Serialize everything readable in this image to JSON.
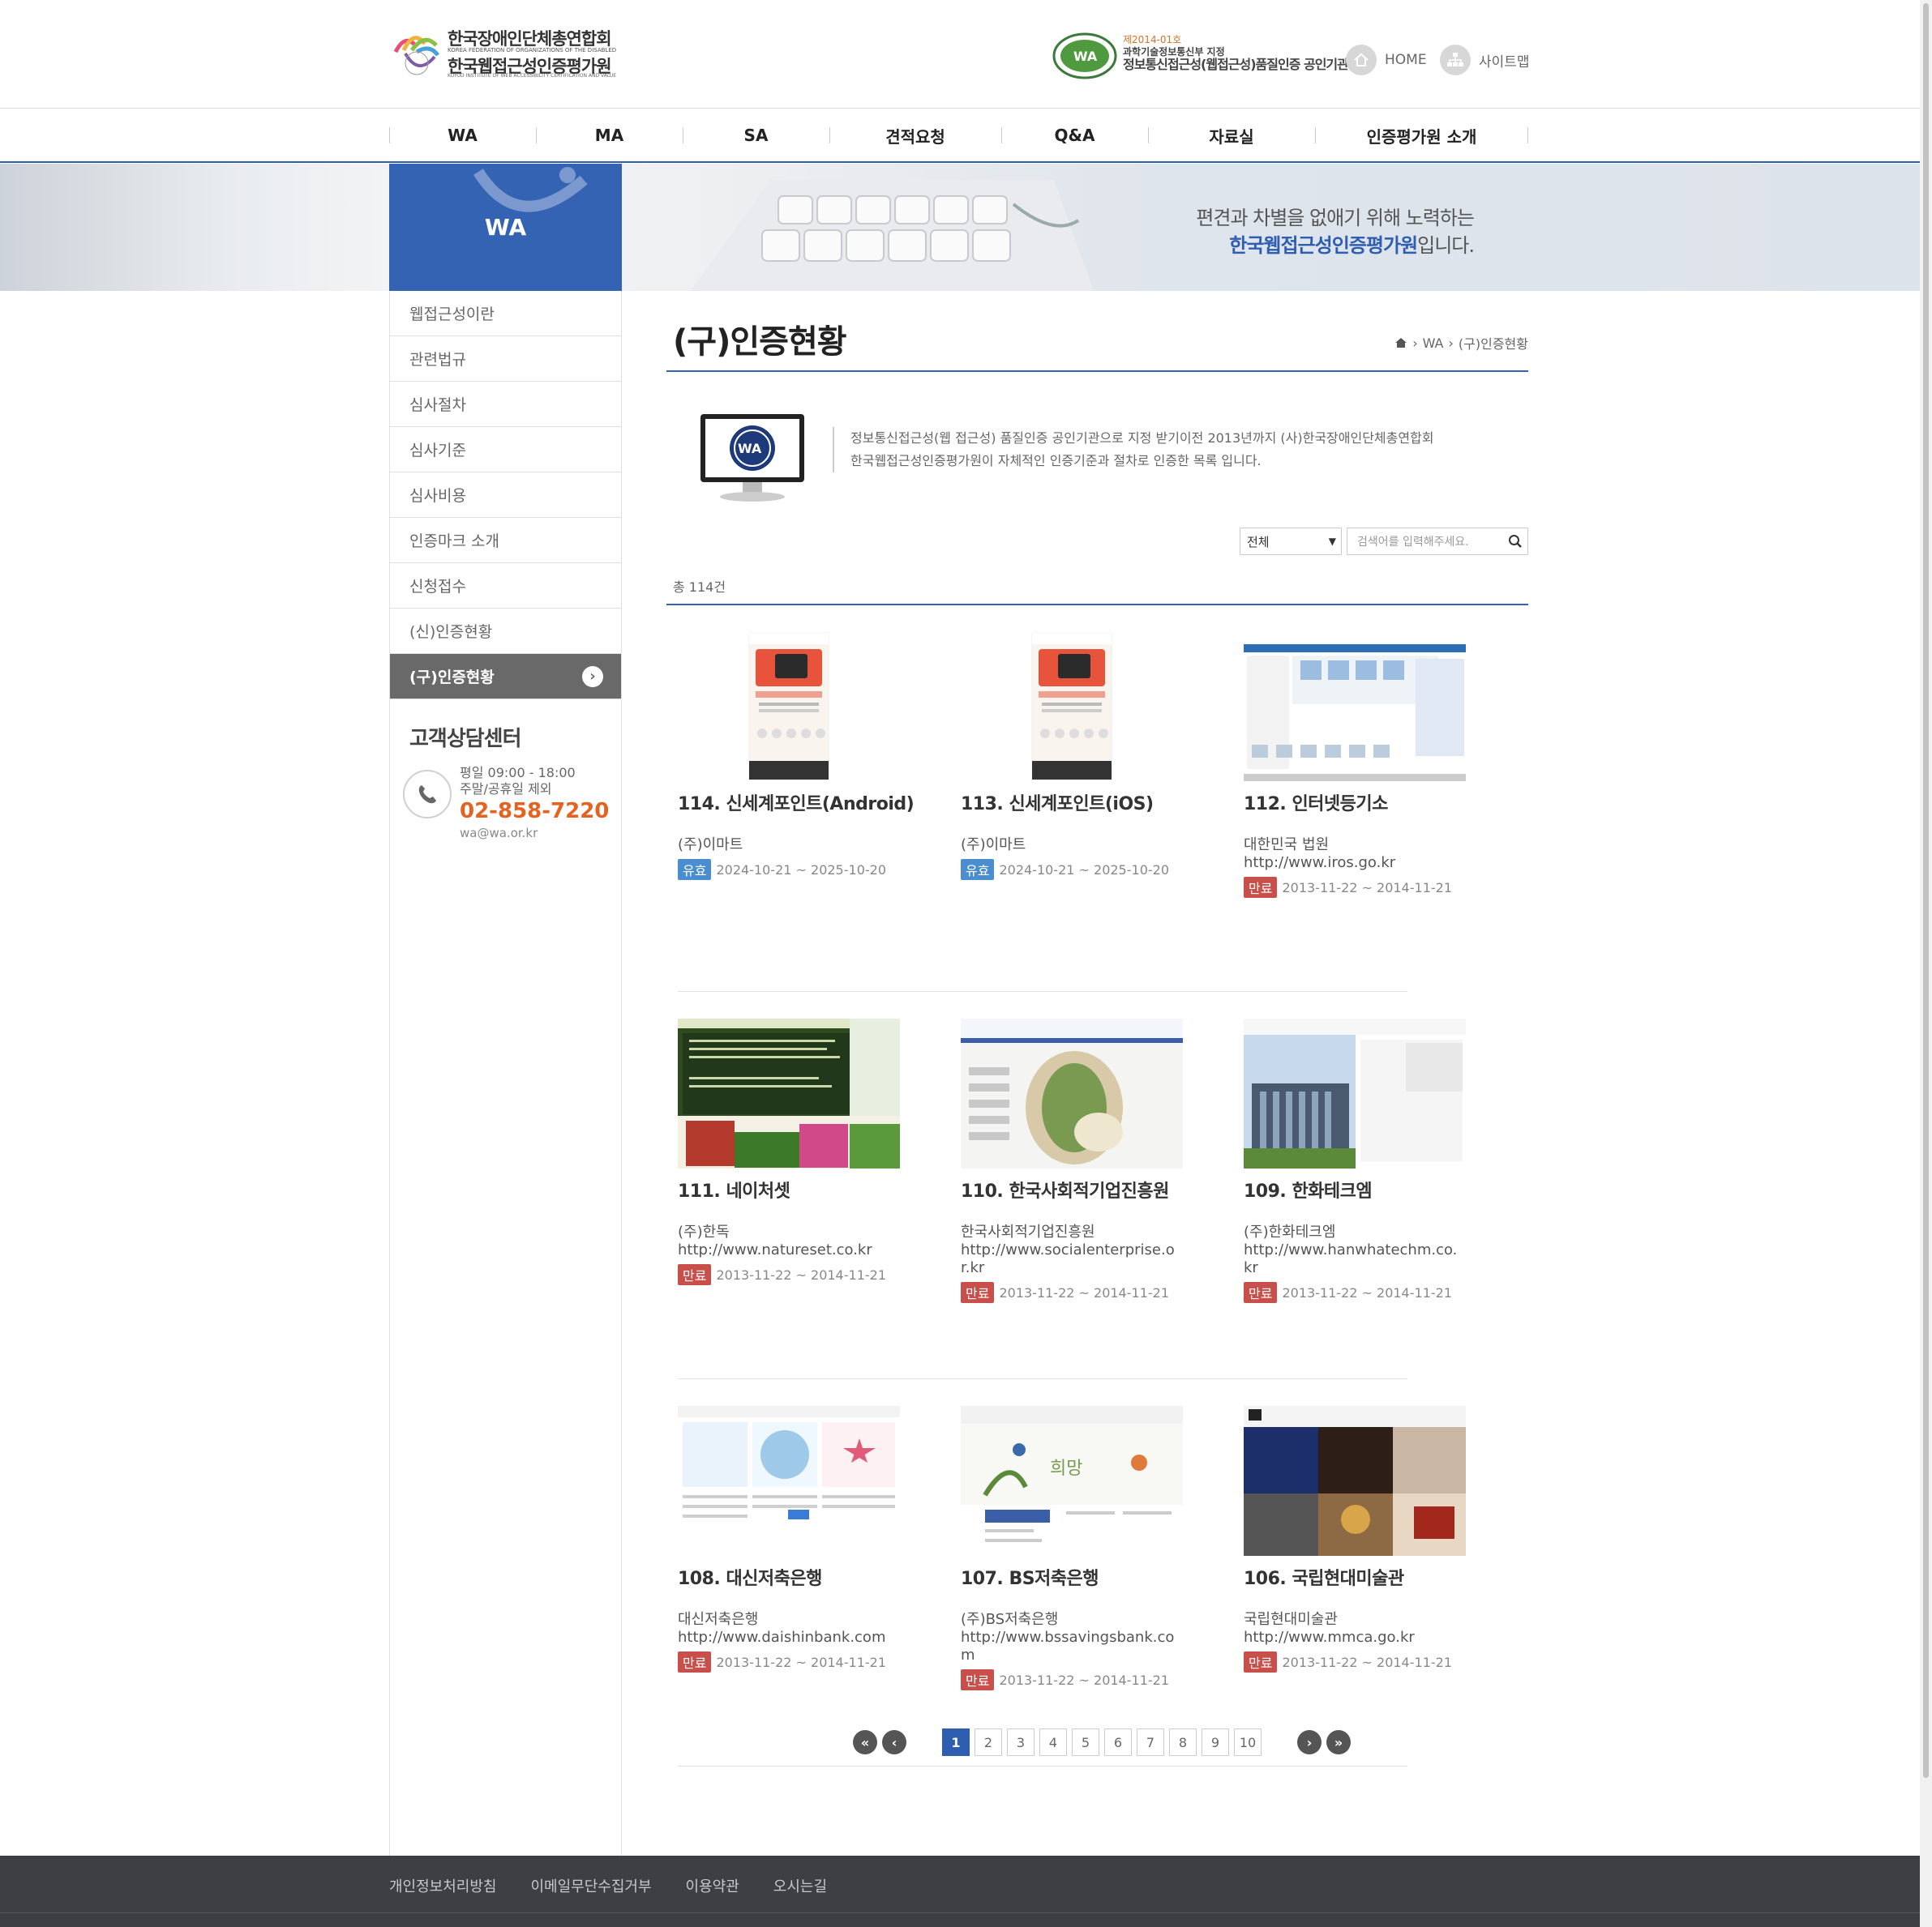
{
  "header": {
    "logo_line1": "한국장애인단체총연합회",
    "logo_sub": "KOREA FEDERATION OF ORGANIZATIONS OF THE DISABLED",
    "logo_line2": "한국웹접근성인증평가원",
    "logo_sub2": "KOYOD INSTITUTE OF WEB ACCESSIBILITY CERTIFICATION AND VALUE",
    "cert_no": "제2014-01호",
    "cert_by": "과학기술정보통신부 지정",
    "cert_main": "정보통신접근성(웹접근성)품질인증 공인기관",
    "home": "HOME",
    "sitemap": "사이트맵"
  },
  "gnb": [
    "WA",
    "MA",
    "SA",
    "견적요청",
    "Q&A",
    "자료실",
    "인증평가원 소개"
  ],
  "visual": {
    "section": "WA",
    "slogan_line1": "편견과 차별을 없애기 위해 노력하는",
    "slogan_line2_strong": "한국웹접근성인증평가원",
    "slogan_line2_rest": "입니다."
  },
  "lnb": [
    "웹접근성이란",
    "관련법규",
    "심사절차",
    "심사기준",
    "심사비용",
    "인증마크 소개",
    "신청접수",
    "(신)인증현황",
    "(구)인증현황"
  ],
  "lnb_active_index": 8,
  "cs": {
    "title": "고객상담센터",
    "hours1": "평일 09:00 - 18:00",
    "hours2": "주말/공휴일 제외",
    "tel": "02-858-7220",
    "email": "wa@wa.or.kr"
  },
  "content": {
    "title": "(구)인증현황",
    "breadcrumb": [
      "WA",
      "(구)인증현황"
    ],
    "intro_line1": "정보통신접근성(웹 접근성) 품질인증 공인기관으로 지정 받기이전 2013년까지 (사)한국장애인단체총연합회",
    "intro_line2": "한국웹접근성인증평가원이 자체적인 인증기준과 절차로 인증한 목록 입니다.",
    "select_value": "전체",
    "search_placeholder": "검색어를 입력해주세요.",
    "total": "총 114건"
  },
  "rows": [
    [
      {
        "title": "114. 신세계포인트(Android)",
        "org": "(주)이마트",
        "url": "",
        "badge": "유효",
        "status": "valid",
        "period": "2024-10-21 ~ 2025-10-20",
        "thumb": "mobile"
      },
      {
        "title": "113. 신세계포인트(iOS)",
        "org": "(주)이마트",
        "url": "",
        "badge": "유효",
        "status": "valid",
        "period": "2024-10-21 ~ 2025-10-20",
        "thumb": "mobile"
      },
      {
        "title": "112. 인터넷등기소",
        "org": "대한민국 법원",
        "url": "http://www.iros.go.kr",
        "badge": "만료",
        "status": "expired",
        "period": "2013-11-22 ~ 2014-11-21",
        "thumb": "iros"
      }
    ],
    [
      {
        "title": "111. 네이처셋",
        "org": "(주)한독",
        "url": "http://www.natureset.co.kr",
        "badge": "만료",
        "status": "expired",
        "period": "2013-11-22 ~ 2014-11-21",
        "thumb": "natureset"
      },
      {
        "title": "110. 한국사회적기업진흥원",
        "org": "한국사회적기업진흥원",
        "url": "http://www.socialenterprise.or.kr",
        "badge": "만료",
        "status": "expired",
        "period": "2013-11-22 ~ 2014-11-21",
        "thumb": "social"
      },
      {
        "title": "109. 한화테크엠",
        "org": "(주)한화테크엠",
        "url": "http://www.hanwhatechm.co.kr",
        "badge": "만료",
        "status": "expired",
        "period": "2013-11-22 ~ 2014-11-21",
        "thumb": "hanwha"
      }
    ],
    [
      {
        "title": "108. 대신저축은행",
        "org": "대신저축은행",
        "url": "http://www.daishinbank.com",
        "badge": "만료",
        "status": "expired",
        "period": "2013-11-22 ~ 2014-11-21",
        "thumb": "daishin"
      },
      {
        "title": "107. BS저축은행",
        "org": "(주)BS저축은행",
        "url": "http://www.bssavingsbank.com",
        "badge": "만료",
        "status": "expired",
        "period": "2013-11-22 ~ 2014-11-21",
        "thumb": "bs"
      },
      {
        "title": "106. 국립현대미술관",
        "org": "국립현대미술관",
        "url": "http://www.mmca.go.kr",
        "badge": "만료",
        "status": "expired",
        "period": "2013-11-22 ~ 2014-11-21",
        "thumb": "mmca"
      }
    ]
  ],
  "paging": {
    "pages": [
      "1",
      "2",
      "3",
      "4",
      "5",
      "6",
      "7",
      "8",
      "9",
      "10"
    ],
    "current": "1"
  },
  "footer": [
    "개인정보처리방침",
    "이메일무단수집거부",
    "이용약관",
    "오시는길"
  ],
  "colors": {
    "primary": "#3463b4",
    "accent": "#e46320",
    "valid": "#4a8ed0",
    "expired": "#c9504a",
    "footer": "#3d3f45"
  }
}
